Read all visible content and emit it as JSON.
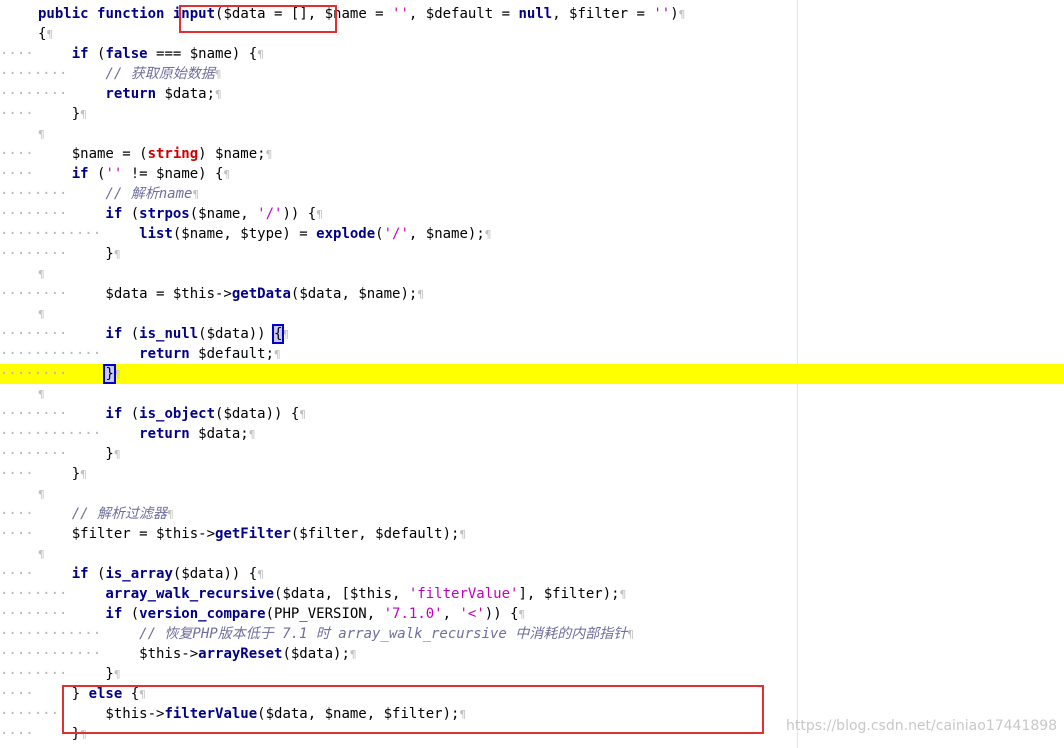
{
  "editor": {
    "pilcrow": "¶",
    "lines": [
      {
        "indent": "",
        "segments": [
          {
            "t": "public ",
            "c": "kw"
          },
          {
            "t": "function ",
            "c": "kw"
          },
          {
            "t": "input",
            "c": "fn"
          },
          {
            "t": "($data = [], $name = ",
            "c": ""
          },
          {
            "t": "''",
            "c": "str"
          },
          {
            "t": ", $default = ",
            "c": ""
          },
          {
            "t": "null",
            "c": "kw"
          },
          {
            "t": ", $filter = ",
            "c": ""
          },
          {
            "t": "''",
            "c": "str"
          },
          {
            "t": ")",
            "c": ""
          }
        ]
      },
      {
        "indent": "",
        "segments": [
          {
            "t": "{",
            "c": ""
          }
        ]
      },
      {
        "indent": "····",
        "segments": [
          {
            "t": "    if ",
            "c": "kw"
          },
          {
            "t": "(",
            "c": ""
          },
          {
            "t": "false",
            "c": "kw"
          },
          {
            "t": " === $name) {",
            "c": ""
          }
        ]
      },
      {
        "indent": "········",
        "segments": [
          {
            "t": "        // 获取原始数据",
            "c": "cm"
          }
        ]
      },
      {
        "indent": "········",
        "segments": [
          {
            "t": "        return ",
            "c": "kw"
          },
          {
            "t": "$data;",
            "c": ""
          }
        ]
      },
      {
        "indent": "····",
        "segments": [
          {
            "t": "    }",
            "c": ""
          }
        ]
      },
      {
        "indent": "",
        "segments": []
      },
      {
        "indent": "····",
        "segments": [
          {
            "t": "    $name = (",
            "c": ""
          },
          {
            "t": "string",
            "c": "cast"
          },
          {
            "t": ") $name;",
            "c": ""
          }
        ]
      },
      {
        "indent": "····",
        "segments": [
          {
            "t": "    if ",
            "c": "kw"
          },
          {
            "t": "(",
            "c": ""
          },
          {
            "t": "''",
            "c": "str"
          },
          {
            "t": " != $name) {",
            "c": ""
          }
        ]
      },
      {
        "indent": "········",
        "segments": [
          {
            "t": "        // 解析name",
            "c": "cm"
          }
        ]
      },
      {
        "indent": "········",
        "segments": [
          {
            "t": "        if ",
            "c": "kw"
          },
          {
            "t": "(",
            "c": ""
          },
          {
            "t": "strpos",
            "c": "fn"
          },
          {
            "t": "($name, ",
            "c": ""
          },
          {
            "t": "'/'",
            "c": "str"
          },
          {
            "t": ")) {",
            "c": ""
          }
        ]
      },
      {
        "indent": "············",
        "segments": [
          {
            "t": "            list",
            "c": "fn"
          },
          {
            "t": "($name, $type) = ",
            "c": ""
          },
          {
            "t": "explode",
            "c": "fn"
          },
          {
            "t": "(",
            "c": ""
          },
          {
            "t": "'/'",
            "c": "str"
          },
          {
            "t": ", $name);",
            "c": ""
          }
        ]
      },
      {
        "indent": "········",
        "segments": [
          {
            "t": "        }",
            "c": ""
          }
        ]
      },
      {
        "indent": "",
        "segments": []
      },
      {
        "indent": "········",
        "segments": [
          {
            "t": "        $data = $this->",
            "c": ""
          },
          {
            "t": "getData",
            "c": "fn"
          },
          {
            "t": "($data, $name);",
            "c": ""
          }
        ]
      },
      {
        "indent": "",
        "segments": []
      },
      {
        "indent": "········",
        "segments": [
          {
            "t": "        if ",
            "c": "kw"
          },
          {
            "t": "(",
            "c": ""
          },
          {
            "t": "is_null",
            "c": "fn"
          },
          {
            "t": "($data)) ",
            "c": ""
          },
          {
            "t": "{",
            "c": "br"
          }
        ]
      },
      {
        "indent": "············",
        "segments": [
          {
            "t": "            return ",
            "c": "kw"
          },
          {
            "t": "$default;",
            "c": ""
          }
        ]
      },
      {
        "indent": "········",
        "current": true,
        "segments": [
          {
            "t": "        ",
            "c": ""
          },
          {
            "t": "}",
            "c": "br"
          }
        ]
      },
      {
        "indent": "",
        "segments": []
      },
      {
        "indent": "········",
        "segments": [
          {
            "t": "        if ",
            "c": "kw"
          },
          {
            "t": "(",
            "c": ""
          },
          {
            "t": "is_object",
            "c": "fn"
          },
          {
            "t": "($data)) {",
            "c": ""
          }
        ]
      },
      {
        "indent": "············",
        "segments": [
          {
            "t": "            return ",
            "c": "kw"
          },
          {
            "t": "$data;",
            "c": ""
          }
        ]
      },
      {
        "indent": "········",
        "segments": [
          {
            "t": "        }",
            "c": ""
          }
        ]
      },
      {
        "indent": "····",
        "segments": [
          {
            "t": "    }",
            "c": ""
          }
        ]
      },
      {
        "indent": "",
        "segments": []
      },
      {
        "indent": "····",
        "segments": [
          {
            "t": "    // 解析过滤器",
            "c": "cm"
          }
        ]
      },
      {
        "indent": "····",
        "segments": [
          {
            "t": "    $filter = $this->",
            "c": ""
          },
          {
            "t": "getFilter",
            "c": "fn"
          },
          {
            "t": "($filter, $default);",
            "c": ""
          }
        ]
      },
      {
        "indent": "",
        "segments": []
      },
      {
        "indent": "····",
        "segments": [
          {
            "t": "    if ",
            "c": "kw"
          },
          {
            "t": "(",
            "c": ""
          },
          {
            "t": "is_array",
            "c": "fn"
          },
          {
            "t": "($data)) {",
            "c": ""
          }
        ]
      },
      {
        "indent": "········",
        "segments": [
          {
            "t": "        array_walk_recursive",
            "c": "fn"
          },
          {
            "t": "($data, [$this, ",
            "c": ""
          },
          {
            "t": "'filterValue'",
            "c": "str"
          },
          {
            "t": "], $filter);",
            "c": ""
          }
        ]
      },
      {
        "indent": "········",
        "segments": [
          {
            "t": "        if ",
            "c": "kw"
          },
          {
            "t": "(",
            "c": ""
          },
          {
            "t": "version_compare",
            "c": "fn"
          },
          {
            "t": "(PHP_VERSION, ",
            "c": ""
          },
          {
            "t": "'7.1.0'",
            "c": "str"
          },
          {
            "t": ", ",
            "c": ""
          },
          {
            "t": "'<'",
            "c": "str"
          },
          {
            "t": ")) {",
            "c": ""
          }
        ]
      },
      {
        "indent": "············",
        "segments": [
          {
            "t": "            // 恢复PHP版本低于 7.1 时 array_walk_recursive 中消耗的内部指针",
            "c": "cm"
          }
        ]
      },
      {
        "indent": "············",
        "segments": [
          {
            "t": "            $this->",
            "c": ""
          },
          {
            "t": "arrayReset",
            "c": "fn"
          },
          {
            "t": "($data);",
            "c": ""
          }
        ]
      },
      {
        "indent": "········",
        "segments": [
          {
            "t": "        }",
            "c": ""
          }
        ]
      },
      {
        "indent": "····",
        "segments": [
          {
            "t": "    } ",
            "c": ""
          },
          {
            "t": "else",
            "c": "kw"
          },
          {
            "t": " {",
            "c": ""
          }
        ]
      },
      {
        "indent": "········",
        "segments": [
          {
            "t": "        $this->",
            "c": ""
          },
          {
            "t": "filterValue",
            "c": "fn"
          },
          {
            "t": "($data, $name, $filter);",
            "c": ""
          }
        ]
      },
      {
        "indent": "····",
        "segments": [
          {
            "t": "    }",
            "c": ""
          }
        ]
      }
    ]
  },
  "watermark": "https://blog.csdn.net/cainiao17441898",
  "colors": {
    "keyword": "#00008b",
    "cast": "#cc0000",
    "string": "#c000c0",
    "comment": "#6e6e9e",
    "current_line": "#ffff00",
    "annotation_box": "#e03030"
  }
}
